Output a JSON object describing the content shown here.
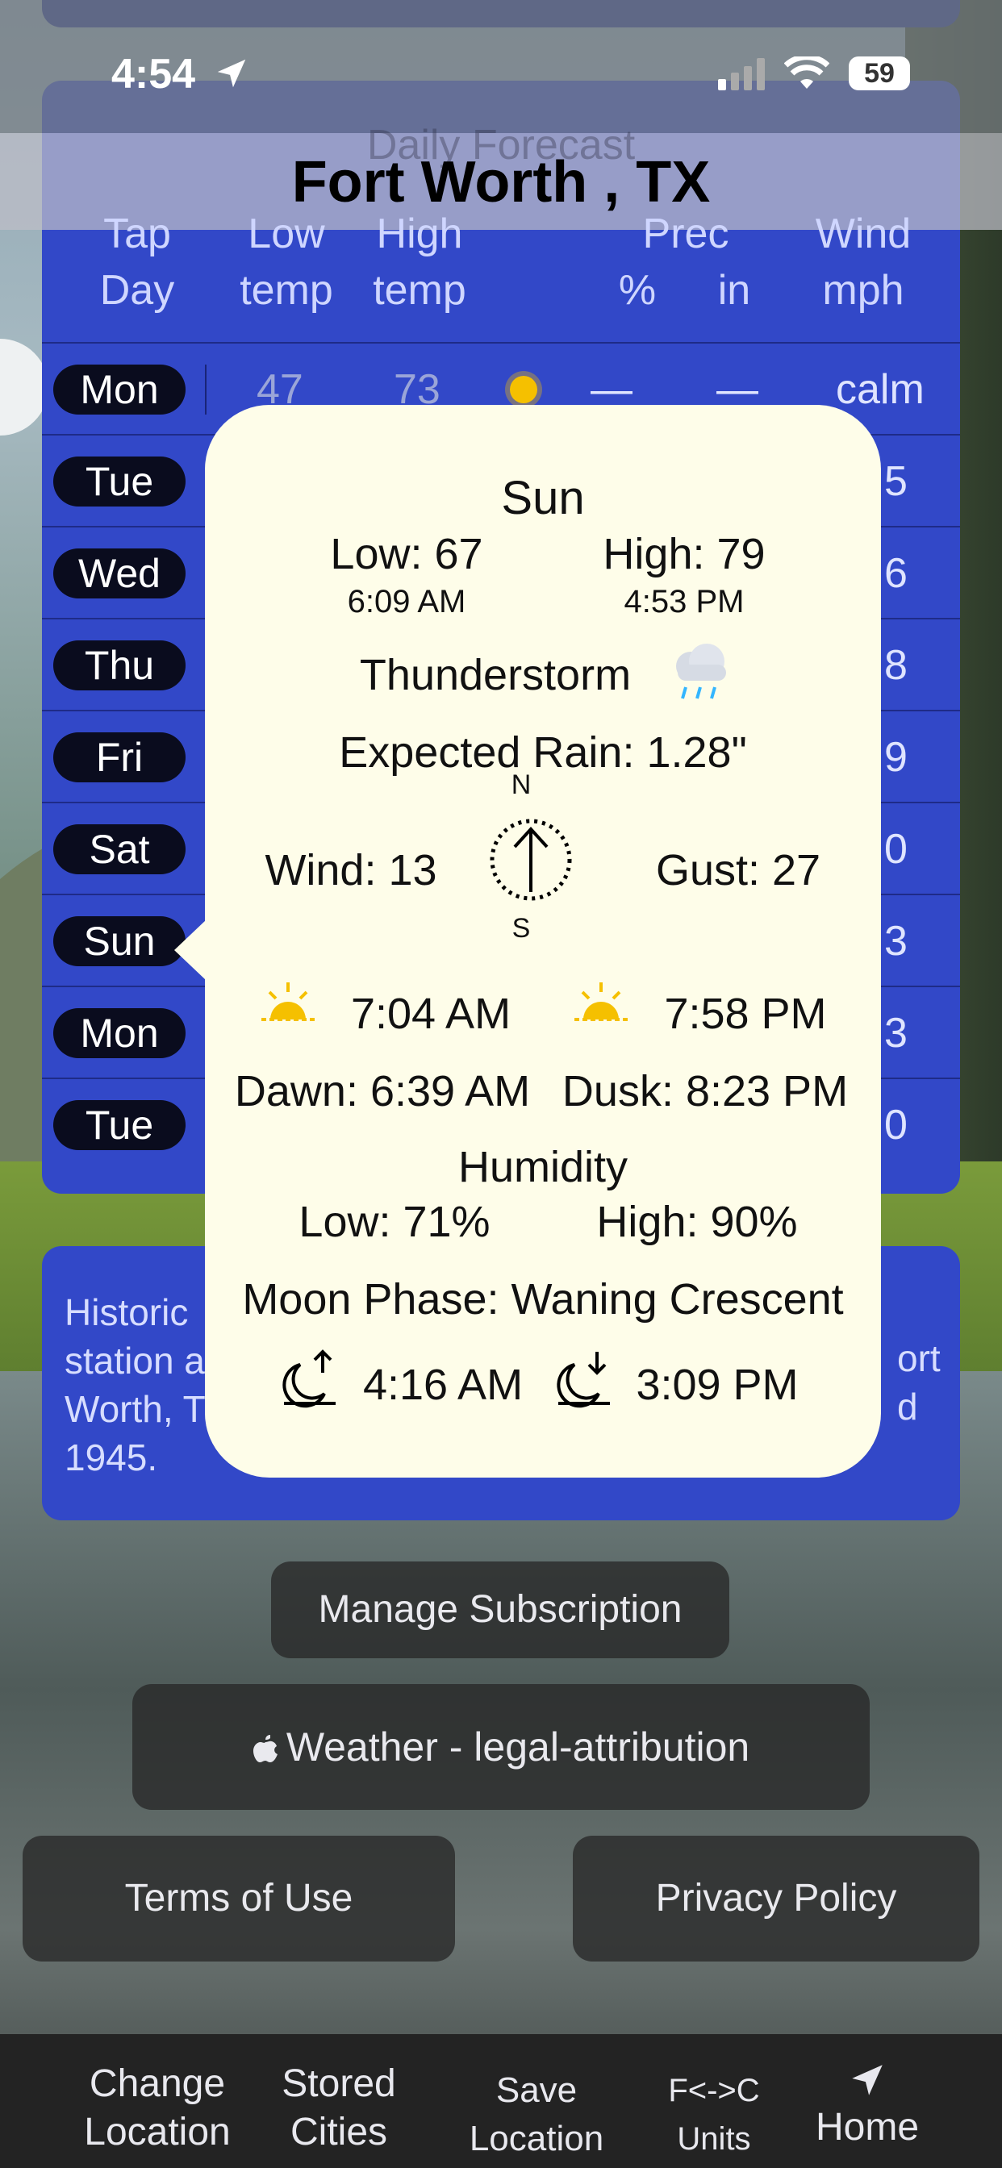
{
  "status_bar": {
    "time": "4:54",
    "battery": "59"
  },
  "header": {
    "section_title": "Daily Forecast",
    "city": "Fort Worth , TX"
  },
  "columns": {
    "day": [
      "Tap",
      "Day"
    ],
    "low": [
      "Low",
      "temp"
    ],
    "high": [
      "High",
      "temp"
    ],
    "prec": [
      "Prec",
      "%",
      "in"
    ],
    "wind": [
      "Wind",
      "mph"
    ]
  },
  "days": [
    {
      "label": "Mon",
      "low": "47",
      "high": "73",
      "prec_pct": "—",
      "prec_in": "—",
      "wind": "calm"
    },
    {
      "label": "Tue",
      "wind": "5"
    },
    {
      "label": "Wed",
      "wind": "6"
    },
    {
      "label": "Thu",
      "wind": "8"
    },
    {
      "label": "Fri",
      "wind": "9"
    },
    {
      "label": "Sat",
      "wind": "0"
    },
    {
      "label": "Sun",
      "wind": "3"
    },
    {
      "label": "Mon",
      "wind": "3"
    },
    {
      "label": "Tue",
      "wind": "0"
    }
  ],
  "history": {
    "line1": "Historic",
    "line2": "station a",
    "line3": "Worth, T",
    "line4": "1945.",
    "right1": "ort",
    "right2": "d"
  },
  "popup": {
    "day": "Sun",
    "low": "Low: 67",
    "low_time": "6:09 AM",
    "high": "High: 79",
    "high_time": "4:53 PM",
    "condition": "Thunderstorm",
    "rain": "Expected Rain: 1.28\"",
    "compass_n": "N",
    "compass_s": "S",
    "wind": "Wind:  13",
    "gust": "Gust:  27",
    "sunrise": "7:04 AM",
    "sunset": "7:58 PM",
    "dawn": "Dawn: 6:39 AM",
    "dusk": "Dusk: 8:23 PM",
    "humidity_title": "Humidity",
    "humidity_low": "Low: 71%",
    "humidity_high": "High: 90%",
    "moon_phase": "Moon Phase: Waning Crescent",
    "moonrise": "4:16 AM",
    "moonset": "3:09 PM"
  },
  "buttons": {
    "manage": "Manage Subscription",
    "legal": "Weather - legal-attribution",
    "terms": "Terms of Use",
    "privacy": "Privacy Policy"
  },
  "tabs": [
    {
      "line1": "Change",
      "line2": "Location"
    },
    {
      "line1": "Stored",
      "line2": "Cities"
    },
    {
      "line1": "Save",
      "line2": "Location"
    },
    {
      "line1": "F<->C",
      "line2": "Units"
    },
    {
      "line1": "",
      "line2": "Home"
    }
  ],
  "colors": {
    "panel": "#3248c8",
    "popup": "#fefde9",
    "sun": "#f5c000"
  }
}
